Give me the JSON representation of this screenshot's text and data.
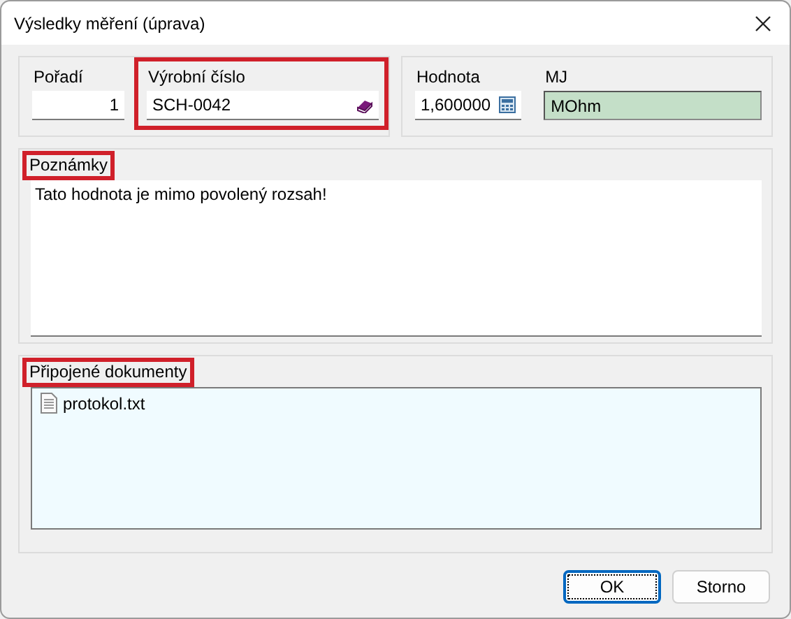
{
  "window": {
    "title": "Výsledky měření (úprava)"
  },
  "field_groups": [
    {
      "fields": [
        {
          "label": "Pořadí",
          "value": "1",
          "kind": "number",
          "highlighted": false
        },
        {
          "label": "Výrobní číslo",
          "value": "SCH-0042",
          "kind": "lookup",
          "highlighted": true
        }
      ]
    },
    {
      "fields": [
        {
          "label": "Hodnota",
          "value": "1,600000",
          "kind": "calc",
          "highlighted": false
        },
        {
          "label": "MJ",
          "value": "MOhm",
          "kind": "readonly",
          "highlighted": false
        }
      ]
    }
  ],
  "notes": {
    "label": "Poznámky",
    "highlighted": true,
    "text": "Tato hodnota je mimo povolený rozsah!"
  },
  "documents": {
    "label": "Připojené dokumenty",
    "highlighted": true,
    "files": [
      {
        "name": "protokol.txt"
      }
    ]
  },
  "buttons": [
    {
      "label": "OK",
      "default": true
    },
    {
      "label": "Storno",
      "default": false
    }
  ]
}
